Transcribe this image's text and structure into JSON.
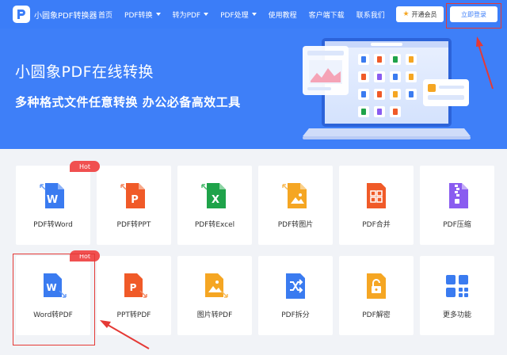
{
  "header": {
    "logo_text": "小圆象PDF转换器",
    "nav": [
      {
        "label": "首页",
        "dropdown": false
      },
      {
        "label": "PDF转换",
        "dropdown": true
      },
      {
        "label": "转为PDF",
        "dropdown": true
      },
      {
        "label": "PDF处理",
        "dropdown": true
      },
      {
        "label": "使用教程",
        "dropdown": false
      },
      {
        "label": "客户端下载",
        "dropdown": false
      },
      {
        "label": "联系我们",
        "dropdown": false
      }
    ],
    "vip_label": "开通会员",
    "login_label": "立即登录"
  },
  "hero": {
    "title": "小圆象PDF在线转换",
    "subtitle": "多种格式文件任意转换 办公必备高效工具"
  },
  "tools": [
    {
      "label": "PDF转Word",
      "icon": "word-file-icon",
      "hot": true
    },
    {
      "label": "PDF转PPT",
      "icon": "ppt-file-icon",
      "hot": false
    },
    {
      "label": "PDF转Excel",
      "icon": "excel-file-icon",
      "hot": false
    },
    {
      "label": "PDF转图片",
      "icon": "image-file-icon",
      "hot": false
    },
    {
      "label": "PDF合并",
      "icon": "merge-file-icon",
      "hot": false
    },
    {
      "label": "PDF压缩",
      "icon": "zip-file-icon",
      "hot": false
    },
    {
      "label": "Word转PDF",
      "icon": "word-to-pdf-icon",
      "hot": true
    },
    {
      "label": "PPT转PDF",
      "icon": "ppt-to-pdf-icon",
      "hot": false
    },
    {
      "label": "图片转PDF",
      "icon": "image-to-pdf-icon",
      "hot": false
    },
    {
      "label": "PDF拆分",
      "icon": "split-file-icon",
      "hot": false
    },
    {
      "label": "PDF解密",
      "icon": "unlock-file-icon",
      "hot": false
    },
    {
      "label": "更多功能",
      "icon": "more-apps-icon",
      "hot": false
    }
  ],
  "hot_label": "Hot",
  "colors": {
    "brand": "#3b7df8",
    "word": "#3a7bf0",
    "ppt": "#f05a28",
    "excel": "#1fa34a",
    "image": "#f5a623",
    "merge": "#f05a28",
    "zip": "#8a5cf0",
    "split": "#3a7bf0",
    "unlock": "#f5a623",
    "hot": "#f05050",
    "annotation": "#e53935"
  }
}
